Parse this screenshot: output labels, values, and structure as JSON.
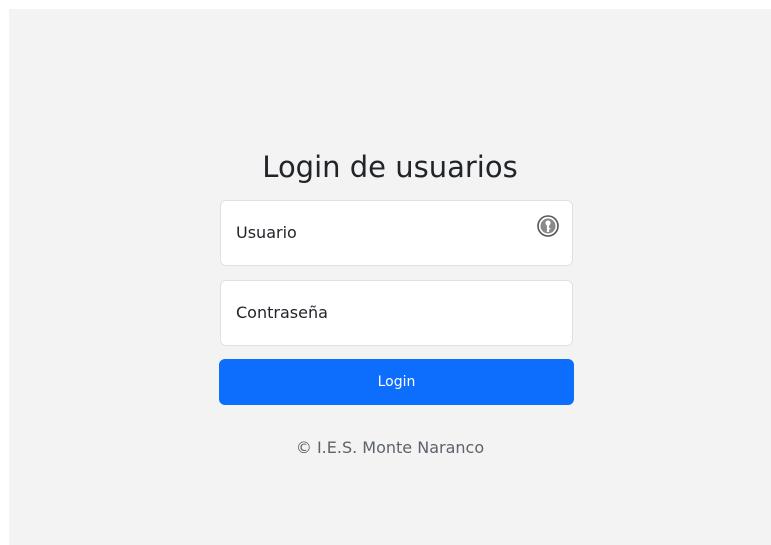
{
  "login": {
    "title": "Login de usuarios",
    "username_placeholder": "Usuario",
    "password_placeholder": "Contraseña",
    "submit_label": "Login",
    "footer": "© I.E.S. Monte Naranco"
  },
  "icons": {
    "password_manager": "keepassxc-key-icon"
  },
  "colors": {
    "background": "#f3f3f3",
    "primary": "#0d6efd",
    "text": "#212529",
    "muted": "#5c636a"
  }
}
